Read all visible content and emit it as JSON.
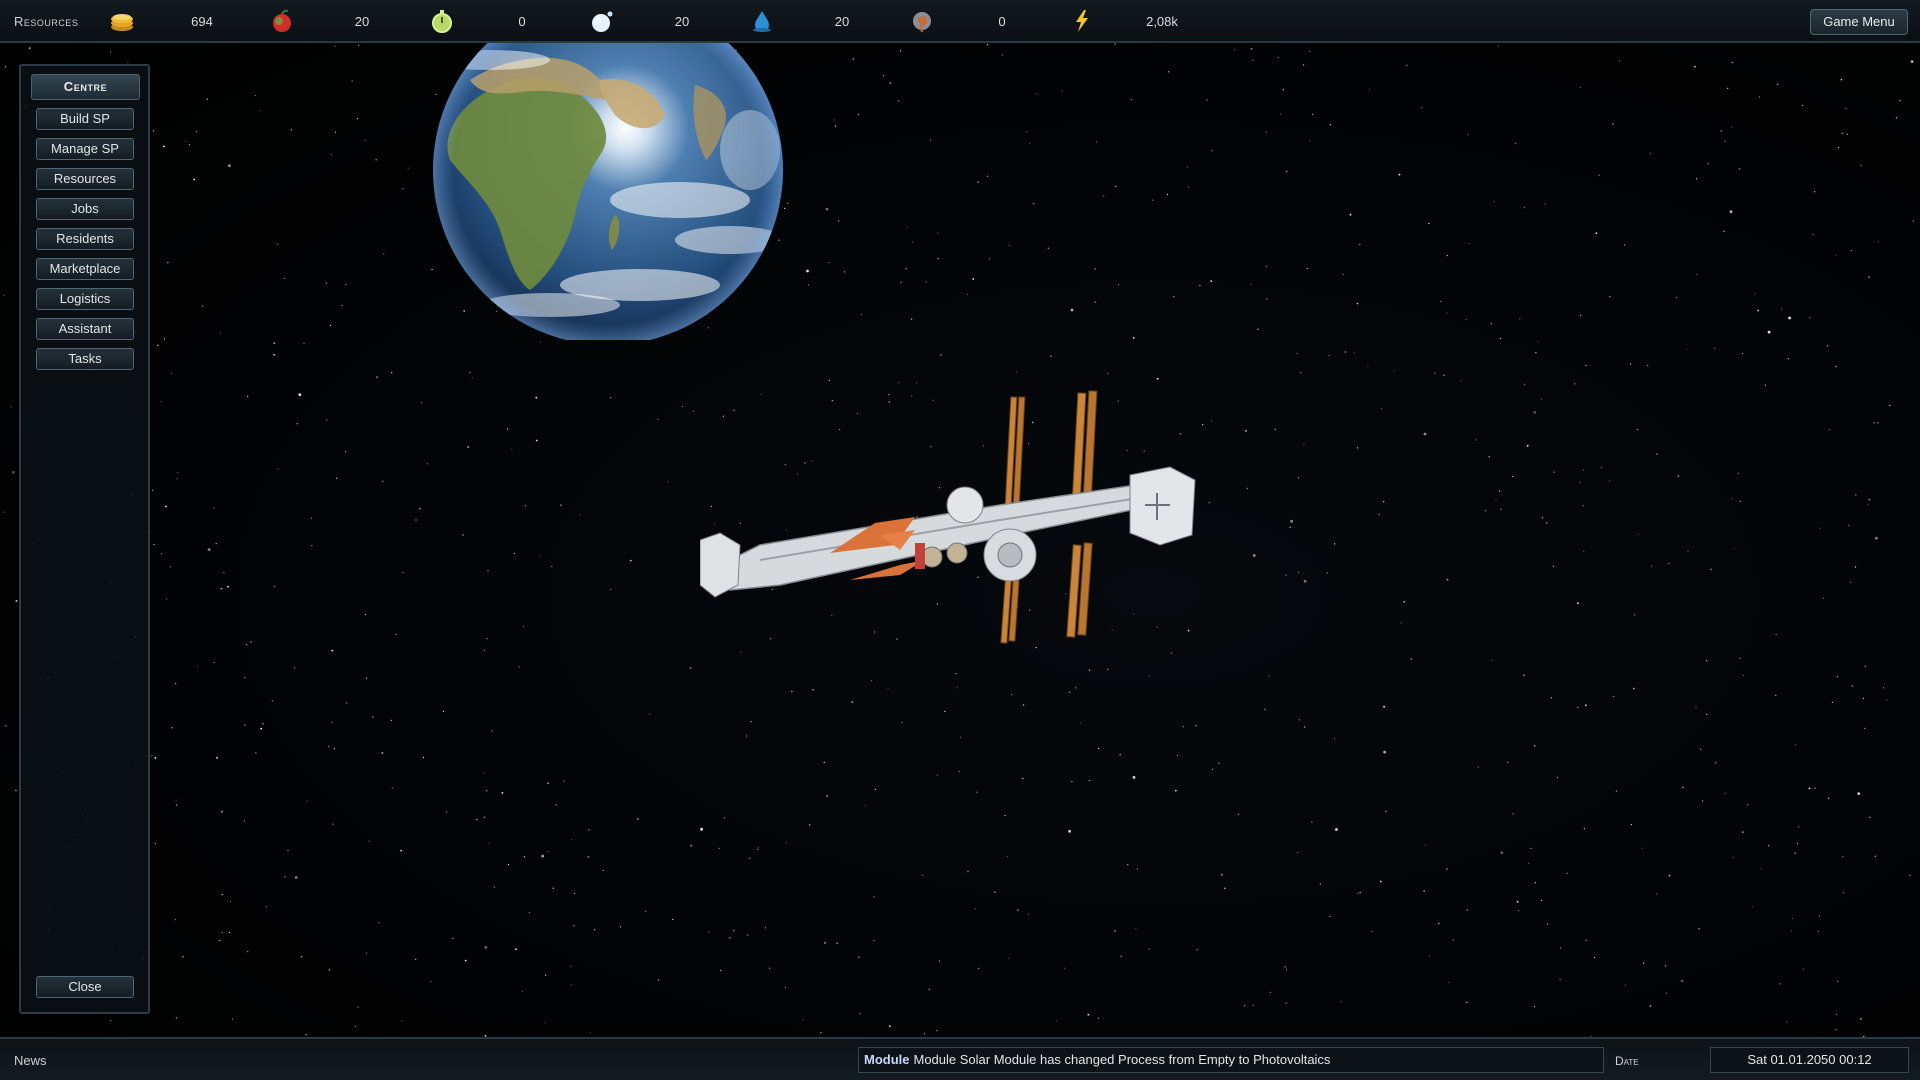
{
  "topbar": {
    "title": "Resources",
    "resources": [
      {
        "icon": "coins-icon",
        "value": "694"
      },
      {
        "icon": "apple-icon",
        "value": "20"
      },
      {
        "icon": "stopwatch-icon",
        "value": "0"
      },
      {
        "icon": "oxygen-bubble-icon",
        "value": "20"
      },
      {
        "icon": "water-drop-icon",
        "value": "20"
      },
      {
        "icon": "ore-icon",
        "value": "0"
      },
      {
        "icon": "lightning-icon",
        "value": "2,08k"
      }
    ],
    "game_menu_label": "Game Menu"
  },
  "sidebar": {
    "header": "Centre",
    "items": [
      {
        "label": "Build SP"
      },
      {
        "label": "Manage SP"
      },
      {
        "label": "Resources"
      },
      {
        "label": "Jobs"
      },
      {
        "label": "Residents"
      },
      {
        "label": "Marketplace"
      },
      {
        "label": "Logistics"
      },
      {
        "label": "Assistant"
      },
      {
        "label": "Tasks"
      }
    ],
    "close_label": "Close"
  },
  "bottombar": {
    "news_label": "News",
    "news_tag": "Module",
    "news_text": "Module Solar Module has changed Process from Empty to Photovoltaics",
    "date_label": "Date",
    "date_value": "Sat 01.01.2050 00:12"
  },
  "colors": {
    "panel_border": "#2b3c47",
    "button_border": "#4d6775",
    "solar_panel": "#c9853a",
    "station_accent": "#d9733a"
  }
}
